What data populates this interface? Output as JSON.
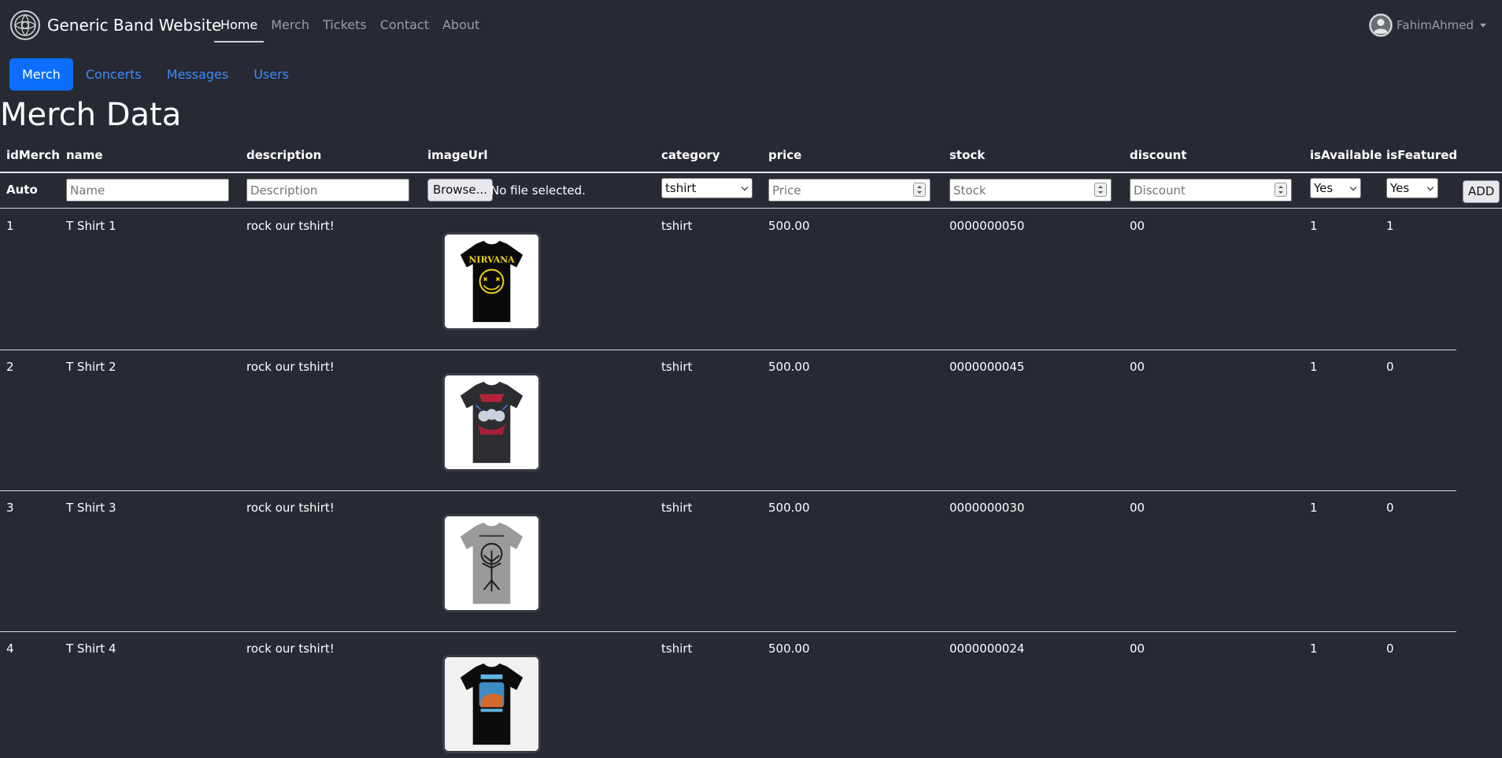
{
  "navbar": {
    "brand_name": "Generic Band Website",
    "links": [
      {
        "label": "Home",
        "active": true
      },
      {
        "label": "Merch",
        "active": false
      },
      {
        "label": "Tickets",
        "active": false
      },
      {
        "label": "Contact",
        "active": false
      },
      {
        "label": "About",
        "active": false
      }
    ],
    "user_name": "FahimAhmed"
  },
  "tabs": [
    {
      "label": "Merch",
      "active": true
    },
    {
      "label": "Concerts",
      "active": false
    },
    {
      "label": "Messages",
      "active": false
    },
    {
      "label": "Users",
      "active": false
    }
  ],
  "page_title": "Merch Data",
  "table": {
    "headers": [
      "idMerch",
      "name",
      "description",
      "imageUrl",
      "category",
      "price",
      "stock",
      "discount",
      "isAvailable",
      "isFeatured"
    ],
    "form": {
      "auto_label": "Auto",
      "name_placeholder": "Name",
      "description_placeholder": "Description",
      "file_button_label": "Browse...",
      "file_status": "No file selected.",
      "category_value": "tshirt",
      "price_placeholder": "Price",
      "stock_placeholder": "Stock",
      "discount_placeholder": "Discount",
      "is_available_value": "Yes",
      "is_featured_value": "Yes",
      "add_label": "ADD"
    },
    "rows": [
      {
        "idMerch": "1",
        "name": "T Shirt 1",
        "description": "rock our tshirt!",
        "category": "tshirt",
        "price": "500.00",
        "stock": "0000000050",
        "discount": "00",
        "isAvailable": "1",
        "isFeatured": "1",
        "image_icon": "nirvana-tshirt-image"
      },
      {
        "idMerch": "2",
        "name": "T Shirt 2",
        "description": "rock our tshirt!",
        "category": "tshirt",
        "price": "500.00",
        "stock": "0000000045",
        "discount": "00",
        "isAvailable": "1",
        "isFeatured": "0",
        "image_icon": "graphic-tshirt-image"
      },
      {
        "idMerch": "3",
        "name": "T Shirt 3",
        "description": "rock our tshirt!",
        "category": "tshirt",
        "price": "500.00",
        "stock": "0000000030",
        "discount": "00",
        "isAvailable": "1",
        "isFeatured": "0",
        "image_icon": "tree-tshirt-image"
      },
      {
        "idMerch": "4",
        "name": "T Shirt 4",
        "description": "rock our tshirt!",
        "category": "tshirt",
        "price": "500.00",
        "stock": "0000000024",
        "discount": "00",
        "isAvailable": "1",
        "isFeatured": "0",
        "image_icon": "band-tshirt-image"
      }
    ]
  },
  "colors": {
    "background": "#272a33",
    "primary": "#0d6efd",
    "link": "#3d8bfd",
    "nirvana_yellow": "#f2d31b"
  }
}
